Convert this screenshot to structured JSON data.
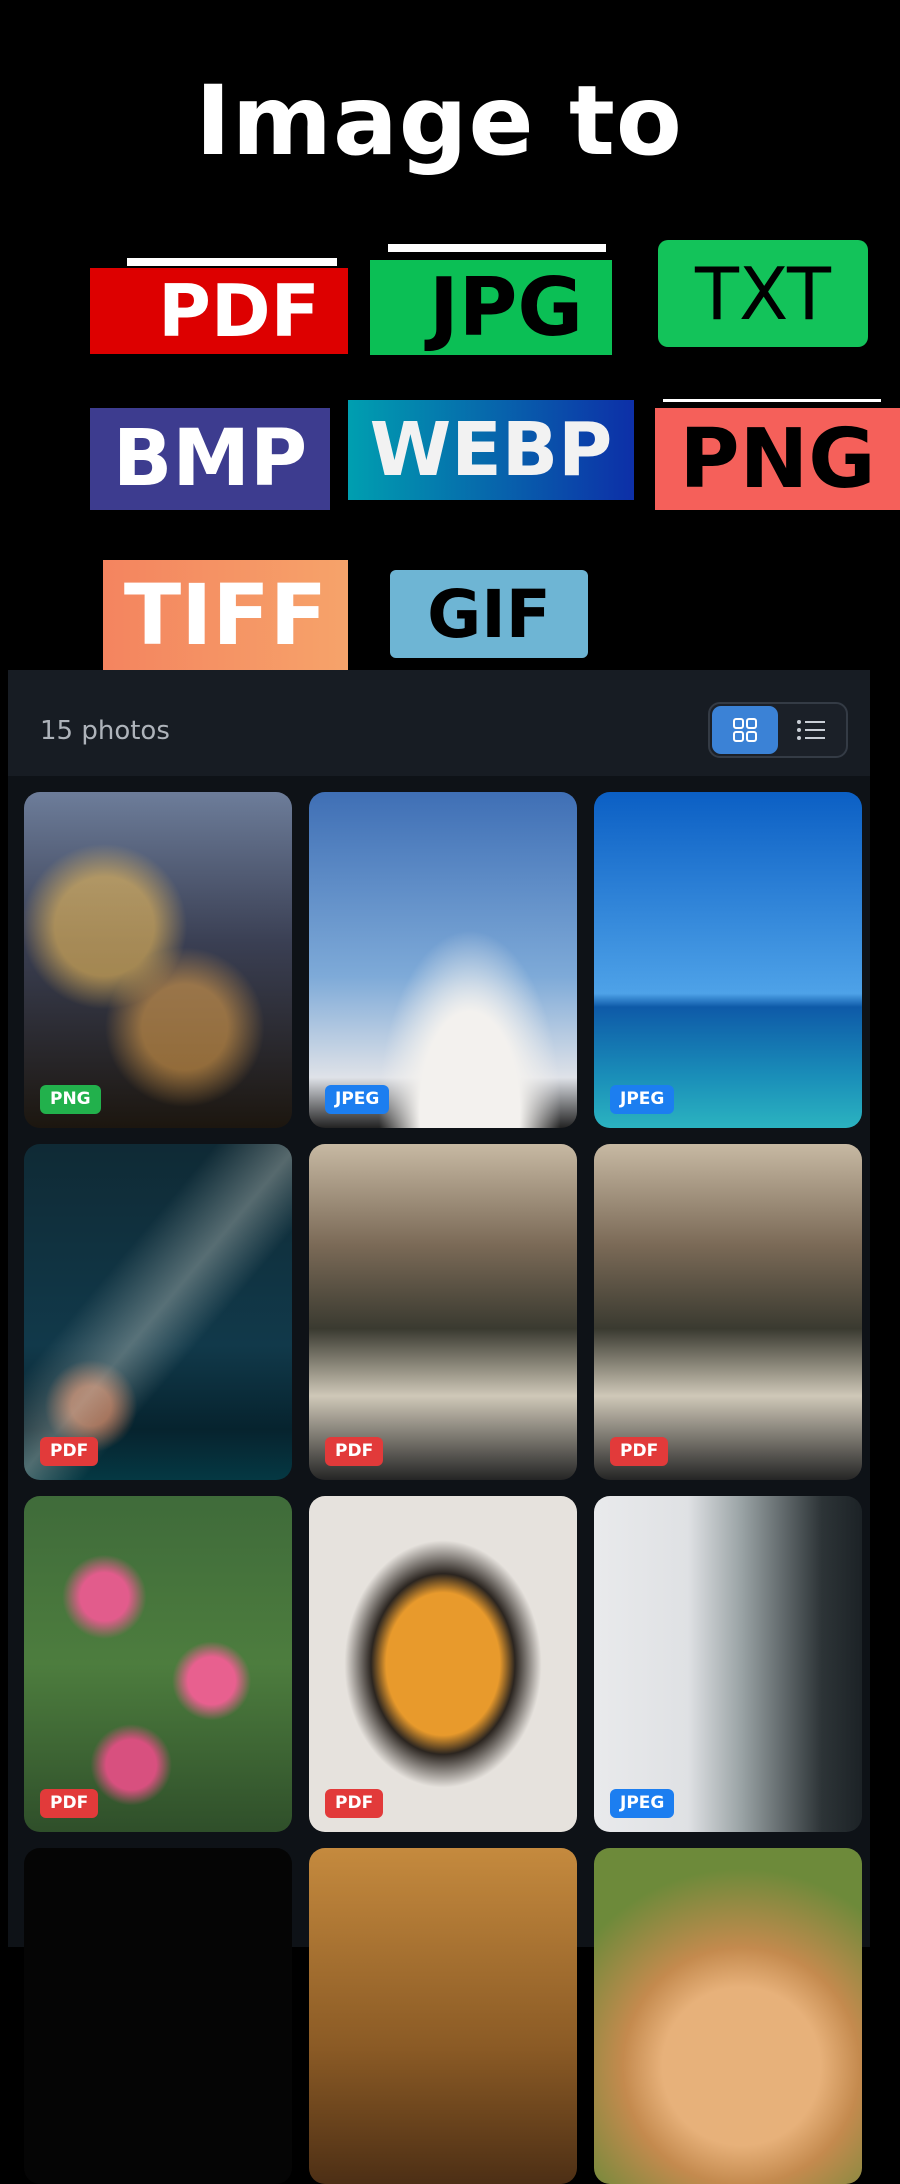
{
  "hero": {
    "title": "Image to",
    "formats": [
      "PDF",
      "JPG",
      "TXT",
      "BMP",
      "WEBP",
      "PNG",
      "TIFF",
      "GIF"
    ]
  },
  "gallery": {
    "count_label": "15 photos",
    "view_toggle": {
      "grid": "grid-view-icon",
      "list": "list-view-icon",
      "selected": "grid"
    },
    "photos": [
      {
        "format": "PNG"
      },
      {
        "format": "JPEG"
      },
      {
        "format": "JPEG"
      },
      {
        "format": "PDF"
      },
      {
        "format": "PDF"
      },
      {
        "format": "PDF"
      },
      {
        "format": "PDF"
      },
      {
        "format": "PDF"
      },
      {
        "format": "JPEG"
      }
    ]
  },
  "colors": {
    "png": "#22b14c",
    "jpeg": "#1c7ef0",
    "pdf": "#e23a3a",
    "accent": "#3b82d6"
  }
}
